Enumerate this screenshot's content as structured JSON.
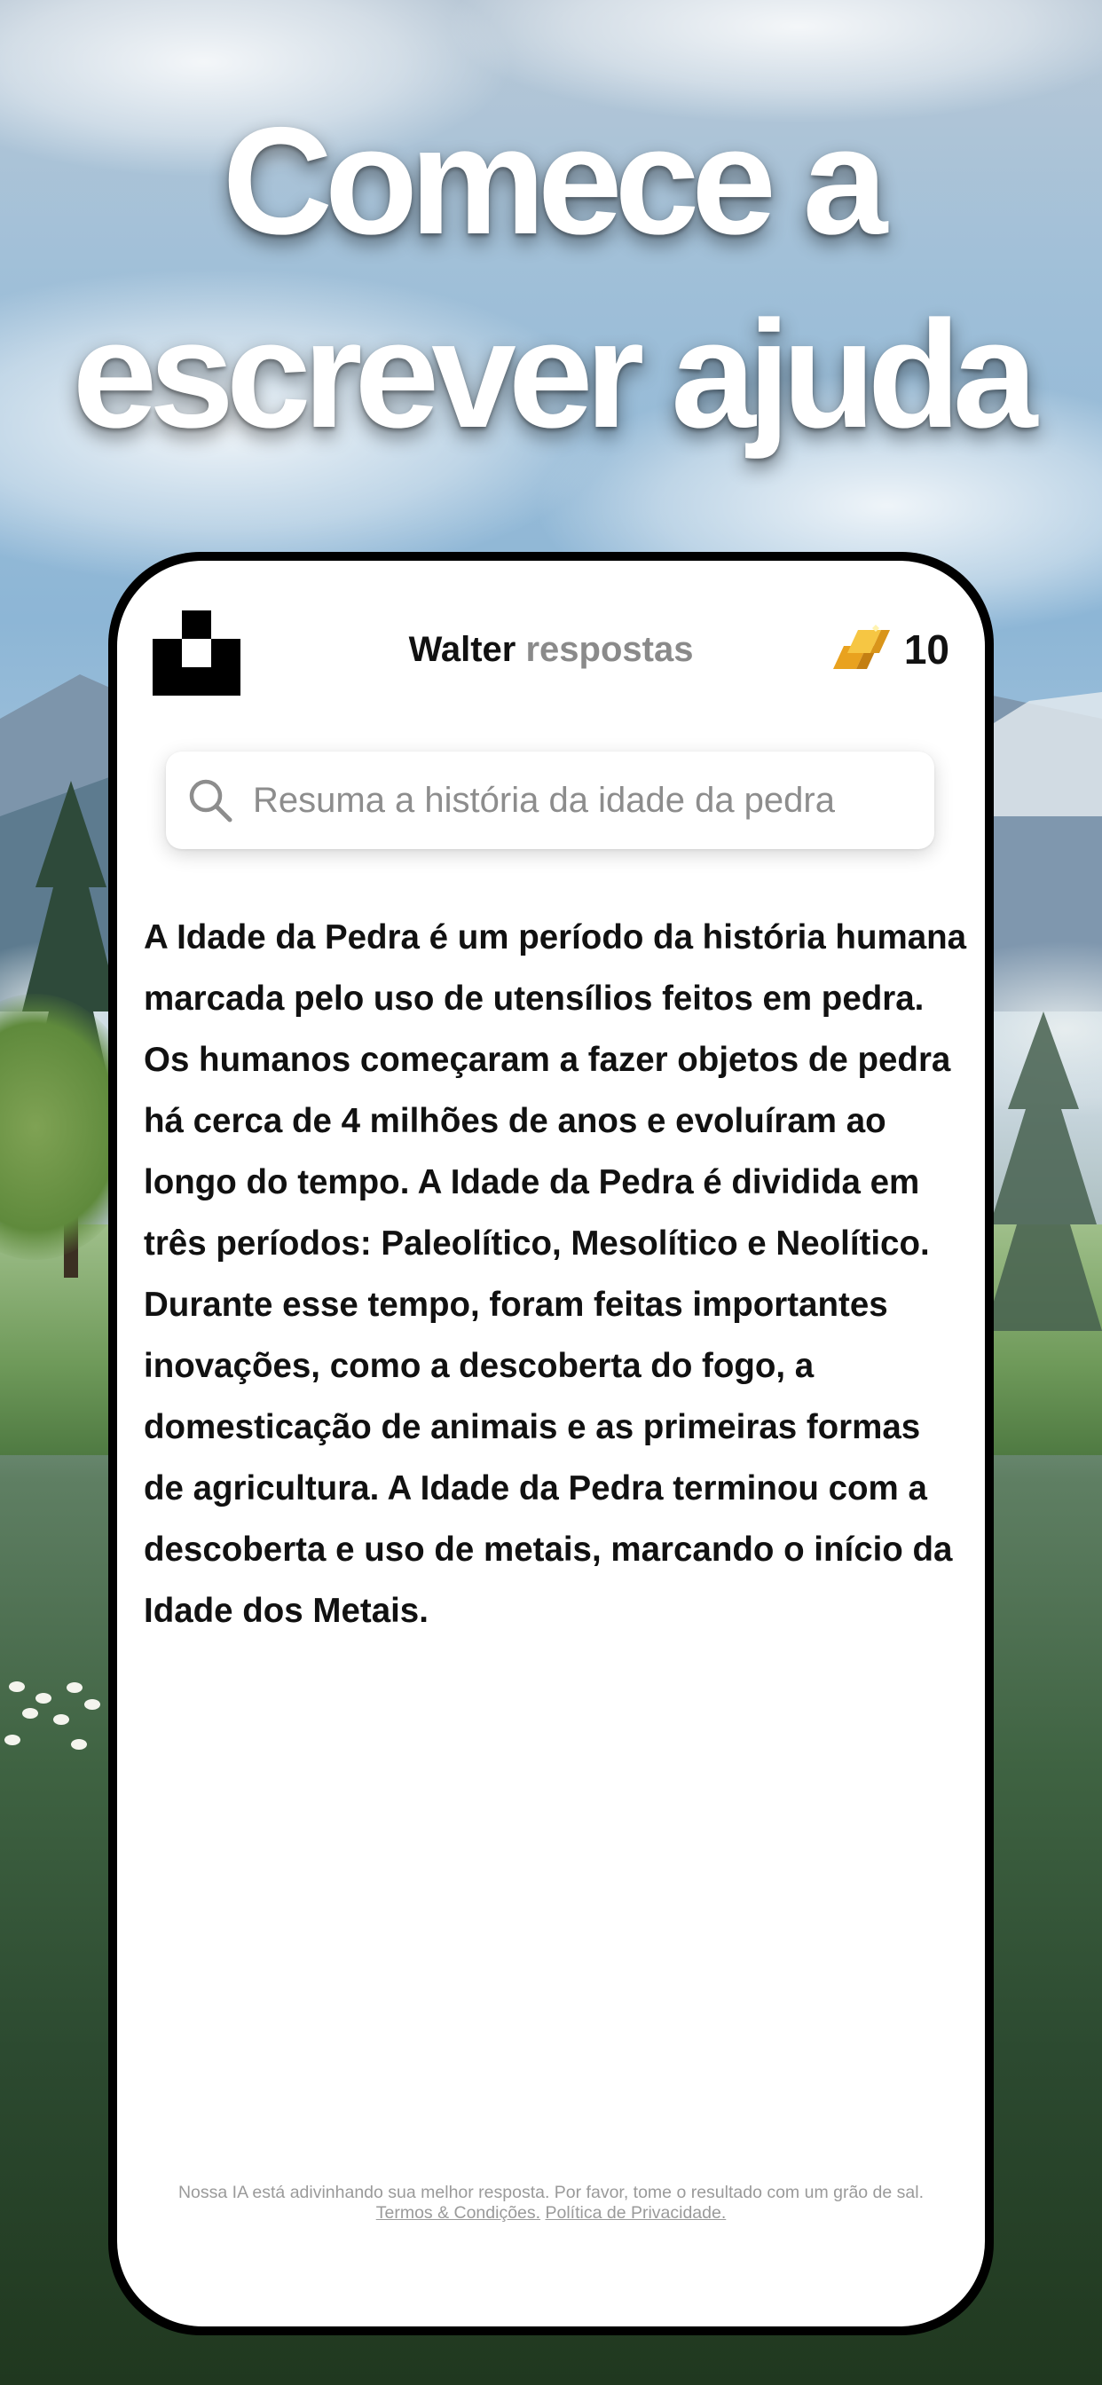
{
  "headline": {
    "line1": "Comece a",
    "line2": "escrever ajuda"
  },
  "app": {
    "title_primary": "Walter",
    "title_secondary": "respostas",
    "credits": "10",
    "logo_icon": "checker-logo-icon",
    "credits_icon": "gold-bars-icon"
  },
  "search": {
    "placeholder": "Resuma a história da idade da pedra",
    "icon": "search-icon"
  },
  "answer": {
    "text": "A Idade da Pedra é um período da história humana marcada pelo uso de utensílios feitos em pedra. Os humanos começaram a fazer objetos de pedra há cerca de 4 milhões de anos e evoluíram ao longo do tempo. A Idade da Pedra é dividida em três períodos: Paleolítico, Mesolítico e Neolítico. Durante esse tempo, foram feitas importantes inovações, como a descoberta do fogo, a domesticação de animais e as primeiras formas de agricultura. A Idade da Pedra terminou com a descoberta e uso de metais, marcando o início da Idade dos Metais."
  },
  "footer": {
    "disclaimer": "Nossa IA está adivinhando sua melhor resposta. Por favor, tome o resultado com um grão de sal.",
    "terms_link": "Termos & Condições.",
    "privacy_link": "Política de Privacidade."
  },
  "colors": {
    "title_accent": "#8a8a8a",
    "gold": "#f2b630",
    "phone_frame": "#000000"
  }
}
